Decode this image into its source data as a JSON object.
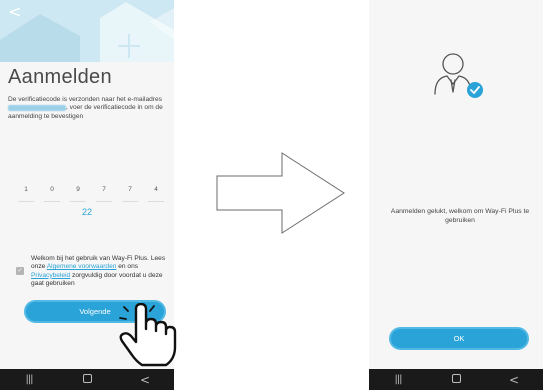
{
  "left_screen": {
    "back_symbol": "<",
    "title": "Aanmelden",
    "description_before": "De verificatiecode is verzonden naar het e-mailadres ",
    "description_after": ", voer de verificatiecode in om de aanmelding te bevestigen",
    "code_digits": [
      "1",
      "0",
      "9",
      "7",
      "7",
      "4"
    ],
    "countdown": "22",
    "consent": {
      "checked": true,
      "check_symbol": "✓",
      "text_1": "Welkom bij het gebruik van Way-Fi Plus. Lees onze ",
      "link_terms": "Algemene voorwaarden",
      "text_2": " en ons ",
      "link_privacy": "Privacybeleid",
      "text_3": " zorgvuldig door voordat u deze gaat gebruiken"
    },
    "next_button": "Volgende"
  },
  "right_screen": {
    "success_message": "Aanmelden gelukt, welkom om Way-Fi Plus te gebruiken",
    "ok_button": "OK"
  },
  "navbar": {
    "recents_symbol": "|||",
    "back_symbol": "<"
  },
  "colors": {
    "accent": "#2aa3d8",
    "navbar": "#1a1a1a",
    "screen_bg": "#f6f6f6",
    "header_bg": "#cde8f2",
    "check_badge": "#2aa3d8"
  },
  "icons": [
    "back-icon",
    "house-illustration-icon",
    "checkbox-icon",
    "pointing-hand-icon",
    "right-arrow-icon",
    "user-avatar-icon",
    "verified-badge-icon",
    "recents-icon",
    "home-icon",
    "nav-back-icon"
  ]
}
